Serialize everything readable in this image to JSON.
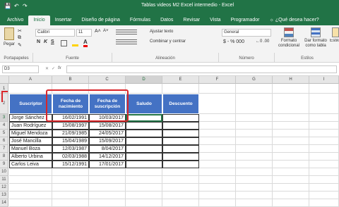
{
  "titlebar": {
    "title": "Tablas videos M2 Excel intermedio  -  Excel"
  },
  "tabs": [
    "Archivo",
    "Inicio",
    "Insertar",
    "Diseño de página",
    "Fórmulas",
    "Datos",
    "Revisar",
    "Vista",
    "Programador"
  ],
  "tell_me": "¿Qué desea hacer?",
  "ribbon": {
    "paste": "Pegar",
    "clipboard": "Portapapeles",
    "font_name": "Calibri",
    "font_size": "11",
    "font_group": "Fuente",
    "wrap": "Ajustar texto",
    "merge": "Combinar y centrar",
    "alignment_group": "Alineación",
    "number_format": "General",
    "number_group": "Número",
    "cond_format": "Formato condicional",
    "table_format": "Dar formato como tabla",
    "cell_styles": "Estilos de celda",
    "styles_group": "Estilos",
    "bold": "N",
    "italic": "K",
    "underline": "S"
  },
  "namebox": "D3",
  "fx": "fx",
  "columns": [
    "A",
    "B",
    "C",
    "D",
    "E",
    "F",
    "G",
    "H",
    "I"
  ],
  "rows": [
    "1",
    "2",
    "3",
    "4",
    "5",
    "6",
    "7",
    "8",
    "9",
    "10",
    "11",
    "12",
    "13",
    "14"
  ],
  "table": {
    "headers": [
      "Suscriptor",
      "Fecha de nacimiento",
      "Fecha de suscripción",
      "Saludo",
      "Descuento"
    ],
    "data": [
      [
        "Jorge Sánchez",
        "16/02/1991",
        "10/03/2017"
      ],
      [
        "Juan Rodríguez",
        "15/08/1997",
        "15/08/2017"
      ],
      [
        "Miguel Mendoza",
        "21/09/1985",
        "24/05/2017"
      ],
      [
        "José Mancilla",
        "15/04/1989",
        "15/09/2017"
      ],
      [
        "Manuel Boza",
        "12/03/1987",
        "8/04/2017"
      ],
      [
        "Alberto Urbina",
        "02/03/1988",
        "14/12/2017"
      ],
      [
        "Carlos Leiva",
        "15/12/1991",
        "17/01/2017"
      ]
    ]
  },
  "colors": {
    "excel_green": "#217346",
    "header_blue": "#4472c4",
    "annotation_red": "#d9262a"
  }
}
